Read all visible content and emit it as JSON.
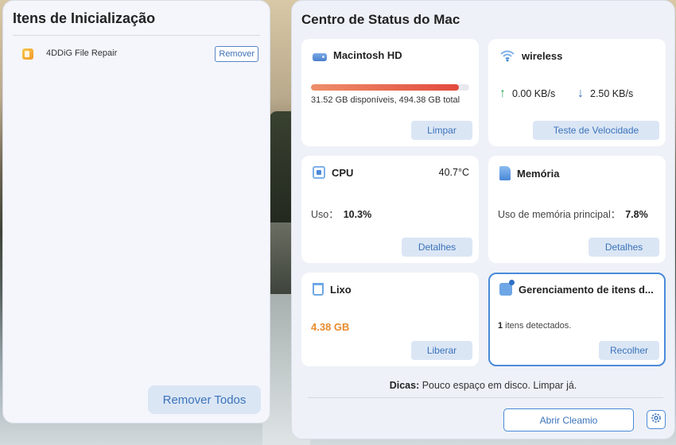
{
  "startup_panel": {
    "title": "Itens de Inicialização",
    "items": [
      {
        "name": "4DDiG File Repair",
        "action": "Remover",
        "icon": "app-icon"
      }
    ],
    "remove_all": "Remover Todos"
  },
  "status_panel": {
    "title": "Centro de Status do Mac",
    "disk": {
      "title": "Macintosh HD",
      "icon": "disk-icon",
      "used_fraction": 0.936,
      "usage_text": "31.52 GB disponíveis, 494.38 GB total",
      "button": "Limpar"
    },
    "network": {
      "title": "wireless",
      "icon": "wifi-icon",
      "upload": "0.00 KB/s",
      "download": "2.50 KB/s",
      "button": "Teste de Velocidade"
    },
    "cpu": {
      "title": "CPU",
      "icon": "cpu-icon",
      "temperature": "40.7°C",
      "usage_label": "Uso：",
      "usage_value": "10.3%",
      "button": "Detalhes"
    },
    "memory": {
      "title": "Memória",
      "icon": "memory-icon",
      "usage_label": "Uso de memória principal：",
      "usage_value": "7.8%",
      "button": "Detalhes"
    },
    "trash": {
      "title": "Lixo",
      "icon": "trash-icon",
      "size": "4.38  GB",
      "button": "Liberar"
    },
    "items_manager": {
      "title": "Gerenciamento de itens d...",
      "icon": "manage-icon",
      "count": "1",
      "detected_text": " itens detectados.",
      "button": "Recolher"
    },
    "tips_label": "Dicas:",
    "tips_text": " Pouco espaço em disco. Limpar já.",
    "open_button": "Abrir Cleamio",
    "colors": {
      "accent": "#3b73ba",
      "progress_start": "#ee8f6a",
      "progress_end": "#e24a3d",
      "trash_size": "#e88b2f",
      "upload_arrow": "#36a85a"
    }
  }
}
